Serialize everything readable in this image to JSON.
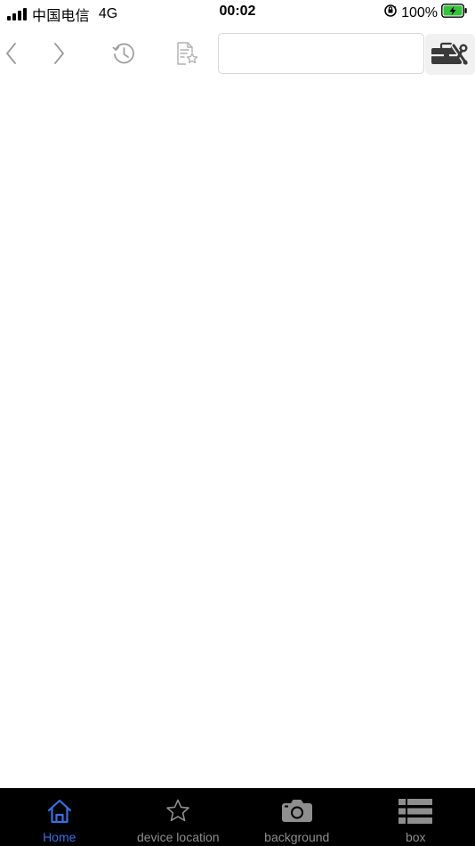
{
  "status_bar": {
    "carrier": "中国电信",
    "network": "4G",
    "time": "00:02",
    "battery_percent": "100%",
    "battery_color": "#36c23a"
  },
  "toolbar": {
    "back_icon": "chevron-left-icon",
    "forward_icon": "chevron-right-icon",
    "history_icon": "history-icon",
    "favorites_icon": "document-star-icon",
    "url_value": "",
    "url_placeholder": "",
    "tools_icon": "toolbox-icon"
  },
  "tab_bar": {
    "background": "#000000",
    "active_color": "#3b6fe0",
    "inactive_color": "#8e8e8e",
    "tabs": [
      {
        "label": "Home",
        "icon": "home-icon",
        "active": true
      },
      {
        "label": "device location",
        "icon": "star-icon",
        "active": false
      },
      {
        "label": "background",
        "icon": "camera-icon",
        "active": false
      },
      {
        "label": "box",
        "icon": "list-icon",
        "active": false
      }
    ]
  }
}
